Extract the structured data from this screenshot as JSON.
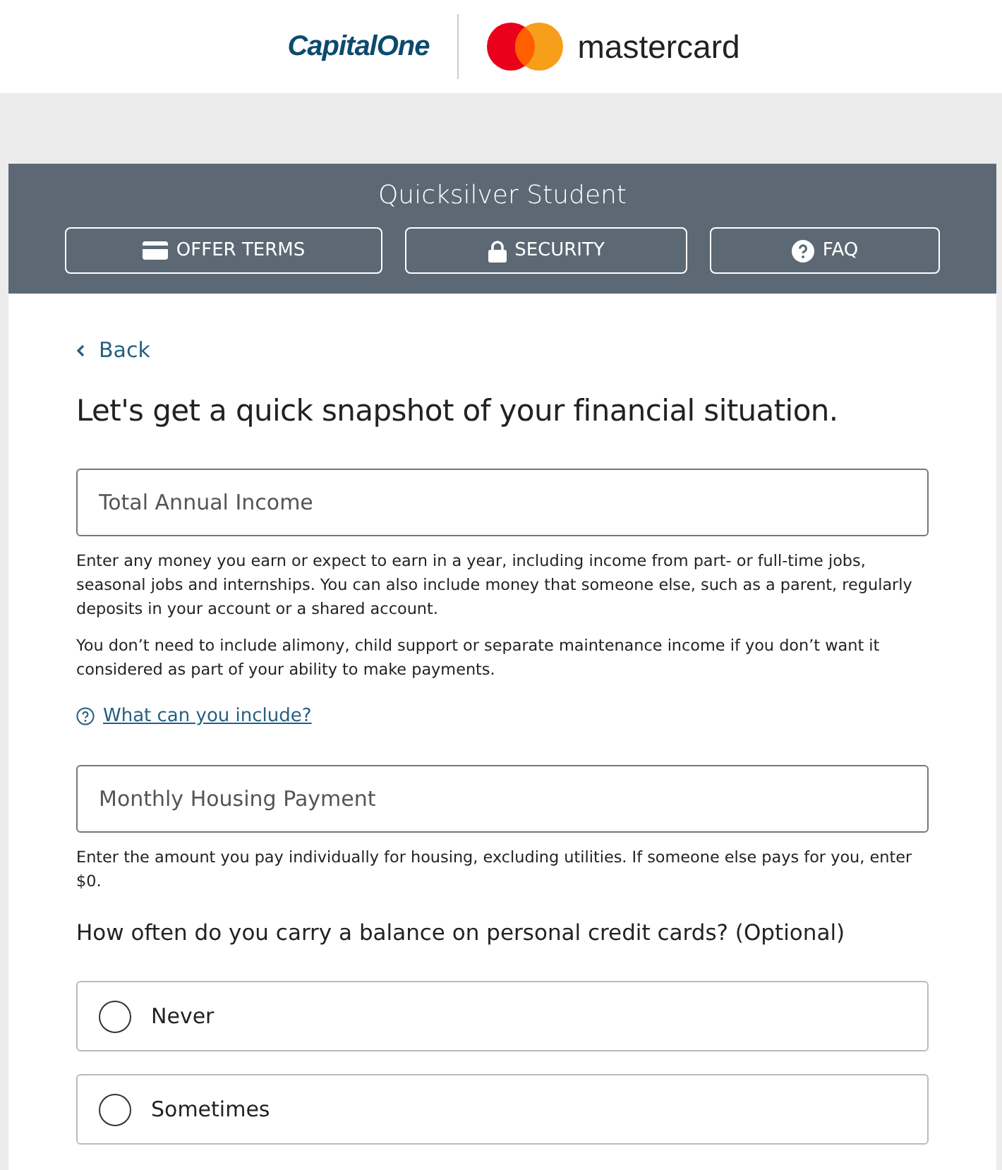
{
  "brand": {
    "issuer": "CapitalOne",
    "network": "mastercard"
  },
  "header": {
    "title": "Quicksilver Student",
    "buttons": [
      {
        "kind": "card",
        "label": "OFFER TERMS"
      },
      {
        "kind": "lock",
        "label": "SECURITY"
      },
      {
        "kind": "question",
        "label": "FAQ"
      }
    ]
  },
  "back": {
    "label": "Back"
  },
  "heading": "Let's get a quick snapshot of your financial situation.",
  "income": {
    "placeholder": "Total Annual Income",
    "help": [
      "Enter any money you earn or expect to earn in a year, including income from part- or full-time jobs, seasonal jobs and internships. You can also include money that someone else, such as a parent, regularly deposits in your account or a shared account.",
      "You don’t need to include alimony, child support or separate maintenance income if you don’t want it considered as part of your ability to make payments."
    ],
    "link": "What can you include?"
  },
  "housing": {
    "placeholder": "Monthly Housing Payment",
    "help": "Enter the amount you pay individually for housing, excluding utilities. If someone else pays for you, enter $0."
  },
  "question": "How often do you carry a balance on personal credit cards? (Optional)",
  "options": [
    {
      "label": "Never",
      "selected": false
    },
    {
      "label": "Sometimes",
      "selected": false
    }
  ]
}
